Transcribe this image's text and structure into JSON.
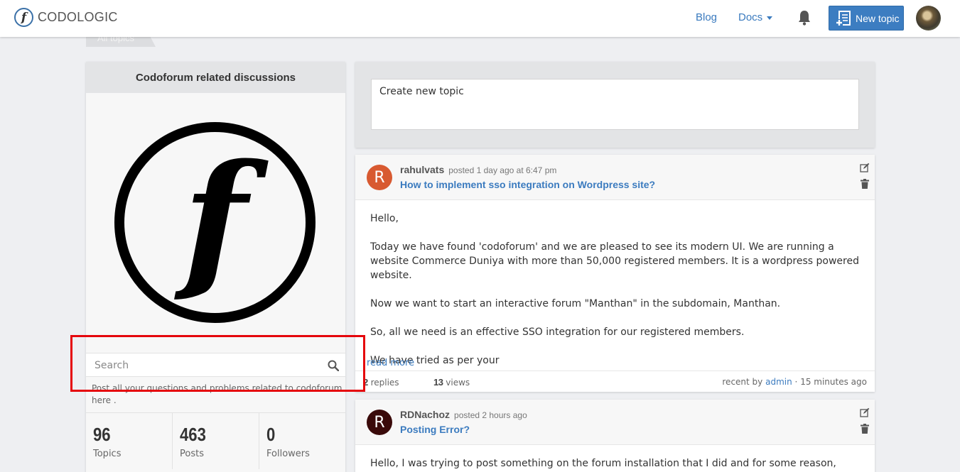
{
  "nav": {
    "brand_name": "CODOLOGIC",
    "brand_letter": "f",
    "blog": "Blog",
    "docs": "Docs",
    "new_topic": "New topic"
  },
  "breadcrumb": "All topics",
  "category": {
    "title": "Codoforum related discussions",
    "logo_letter": "f",
    "search_placeholder": "Search",
    "description": "Post all your questions and problems related to codoforum here .",
    "stats": [
      {
        "num": "96",
        "label": "Topics"
      },
      {
        "num": "463",
        "label": "Posts"
      },
      {
        "num": "0",
        "label": "Followers"
      }
    ]
  },
  "composer": {
    "placeholder": "Create new topic"
  },
  "posts": [
    {
      "avatar_letter": "R",
      "avatar_color": "#d85a31",
      "user": "rahulvats",
      "meta": "posted 1 day ago at 6:47 pm",
      "title": "How to implement sso integration on Wordpress site?",
      "body": [
        "Hello,",
        "Today we have found 'codoforum' and we are pleased to see its modern UI. We are running a website Commerce Duniya with more than 50,000 registered members. It is a wordpress powered website.",
        "Now we want to start an interactive forum \"Manthan\" in the subdomain, Manthan.",
        "So, all we need is an effective SSO integration for our registered members.",
        "We have tried as per your"
      ],
      "read_more": "read more",
      "replies_num": "2",
      "replies_label": "replies",
      "views_num": "13",
      "views_label": "views",
      "recent_by": "recent by",
      "recent_user": "admin",
      "recent_sep": "·",
      "recent_time": "15 minutes ago"
    },
    {
      "avatar_letter": "R",
      "avatar_color": "#3a0a0a",
      "user": "RDNachoz",
      "meta": "posted 2 hours ago",
      "title": "Posting Error?",
      "body": [
        "Hello, I was trying to post something on the forum installation that I did and for some reason, when I hit"
      ]
    }
  ]
}
